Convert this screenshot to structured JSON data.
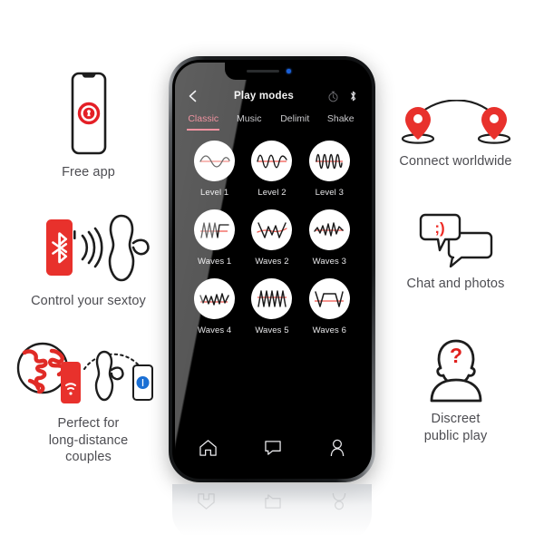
{
  "features_left": [
    {
      "id": "free-app",
      "label": "Free app",
      "art": "phone-with-logo",
      "accent": "#e41f26"
    },
    {
      "id": "control-sextoy",
      "label": "Control your sextoy",
      "art": "red-phone-bluetooth-toy",
      "accent": "#e8312c"
    },
    {
      "id": "long-distance",
      "label": "Perfect for\nlong-distance\ncouples",
      "art": "globe-phones-toy",
      "accent": "#e02b26"
    }
  ],
  "features_right": [
    {
      "id": "connect-worldwide",
      "label": "Connect worldwide",
      "art": "two-map-pins-arc",
      "accent": "#e8312c"
    },
    {
      "id": "chat-photos",
      "label": "Chat and photos",
      "art": "two-chat-bubbles-wink",
      "accent": "#ee2a24",
      "emoticon": ";)"
    },
    {
      "id": "discreet-play",
      "label": "Discreet\npublic play",
      "art": "anonymous-person-question",
      "accent": "#e0201d",
      "glyph": "?"
    }
  ],
  "phone": {
    "app": {
      "header": {
        "title": "Play modes",
        "back_icon": "chevron-left-icon",
        "timer_icon": "timer-icon",
        "bluetooth_icon": "bluetooth-icon"
      },
      "tabs": [
        {
          "label": "Classic",
          "active": true
        },
        {
          "label": "Music",
          "active": false
        },
        {
          "label": "Delimit",
          "active": false
        },
        {
          "label": "Shake",
          "active": false
        }
      ],
      "active_tab_color": "#e8576b",
      "modes": [
        {
          "label": "Level 1",
          "wave": "sine-low"
        },
        {
          "label": "Level 2",
          "wave": "sine-mid"
        },
        {
          "label": "Level 3",
          "wave": "sine-high"
        },
        {
          "label": "Waves 1",
          "wave": "zigzag-then-flat"
        },
        {
          "label": "Waves 2",
          "wave": "v-peak-v"
        },
        {
          "label": "Waves 3",
          "wave": "zigzag-rising"
        },
        {
          "label": "Waves 4",
          "wave": "zigzag-dense-low"
        },
        {
          "label": "Waves 5",
          "wave": "triangle-dense"
        },
        {
          "label": "Waves 6",
          "wave": "v-trapezoid-v"
        }
      ],
      "nav": [
        {
          "icon": "home-icon",
          "label": "Home"
        },
        {
          "icon": "chat-icon",
          "label": "Chat"
        },
        {
          "icon": "profile-icon",
          "label": "Profile"
        }
      ],
      "baseline_color": "#f0564e",
      "wave_color": "#1a1a1a"
    }
  }
}
